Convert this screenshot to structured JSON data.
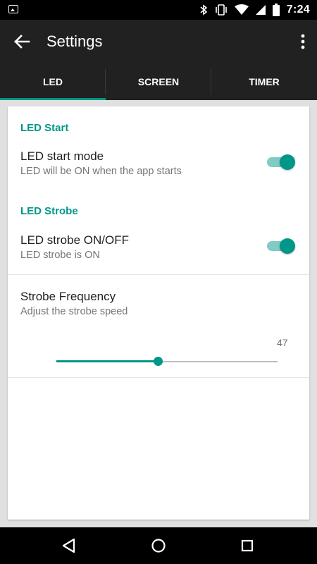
{
  "status_bar": {
    "time": "7:24",
    "icons": [
      "image-notification-icon",
      "bluetooth-icon",
      "vibrate-icon",
      "wifi-icon",
      "signal-icon",
      "battery-icon"
    ]
  },
  "app_bar": {
    "title": "Settings",
    "icons": [
      "back-arrow-icon",
      "more-vert-icon"
    ]
  },
  "tabs": [
    {
      "label": "LED",
      "active": true
    },
    {
      "label": "SCREEN",
      "active": false
    },
    {
      "label": "TIMER",
      "active": false
    }
  ],
  "sections": {
    "led_start": {
      "header": "LED Start",
      "title": "LED start mode",
      "summary": "LED will be ON when the app starts",
      "enabled": true
    },
    "led_strobe": {
      "header": "LED Strobe",
      "title": "LED strobe ON/OFF",
      "summary": "LED strobe is ON",
      "enabled": true
    },
    "strobe_frequency": {
      "title": "Strobe Frequency",
      "summary": "Adjust the strobe speed",
      "value": "47",
      "fraction": 0.46
    }
  },
  "nav_bar": {
    "icons": [
      "back-triangle-icon",
      "home-circle-icon",
      "recents-square-icon"
    ]
  },
  "colors": {
    "accent": "#009688",
    "accent_light": "#80cbc4",
    "toolbar": "#212121"
  }
}
